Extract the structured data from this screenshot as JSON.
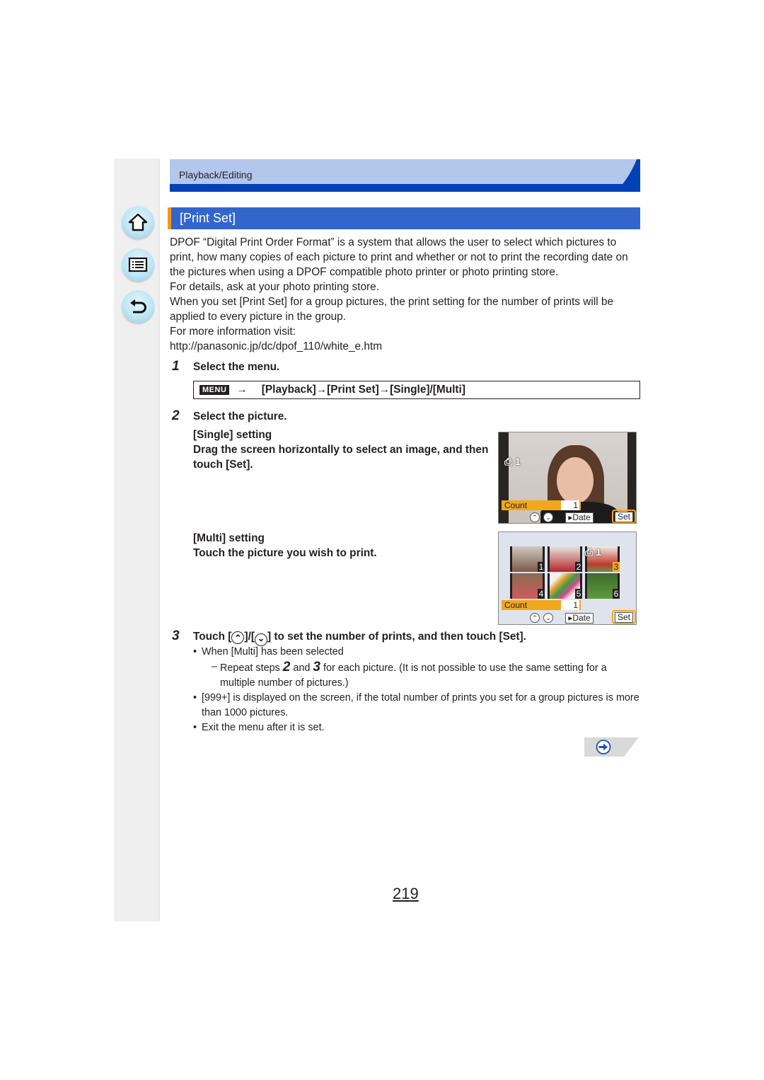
{
  "header": {
    "section": "Playback/Editing"
  },
  "nav": {
    "home_icon": "home-icon",
    "menu_icon": "menu-list-icon",
    "back_icon": "back-arrow-icon"
  },
  "title": "[Print Set]",
  "intro": {
    "p1": "DPOF “Digital Print Order Format” is a system that allows the user to select which pictures to print, how many copies of each picture to print and whether or not to print the recording date on the pictures when using a DPOF compatible photo printer or photo printing store.",
    "p2": "For details, ask at your photo printing store.",
    "p3": "When you set [Print Set] for a group pictures, the print setting for the number of prints will be applied to every picture in the group.",
    "p4": "For more information visit:",
    "url": "http://panasonic.jp/dc/dpof_110/white_e.htm"
  },
  "steps": [
    {
      "number": "1",
      "title": "Select the menu.",
      "menu_badge": "MENU",
      "menu_arrow": "→",
      "menu_path": "[Playback]→[Print Set]→[Single]/[Multi]"
    },
    {
      "number": "2",
      "title": "Select the picture.",
      "single_heading": "[Single] setting",
      "single_instruction": "Drag the screen horizontally to select an image, and then touch [Set].",
      "multi_heading": "[Multi] setting",
      "multi_instruction": "Touch the picture you wish to print."
    },
    {
      "number": "3",
      "title_pre": "Touch [",
      "up_symbol": "⌃",
      "title_mid": "]/[",
      "down_symbol": "⌄",
      "title_post": "] to set the number of prints, and then touch [Set]."
    }
  ],
  "screen_single": {
    "print_mark": "⎙ 1",
    "count_label": "Count",
    "count_value": "1",
    "date_label": "▸Date",
    "set_label": "Set"
  },
  "screen_multi": {
    "print_mark": "⎙ 1",
    "thumbnails": [
      "1",
      "2",
      "3",
      "4",
      "5",
      "6"
    ],
    "selected_thumbnail": "3",
    "count_label": "Count",
    "count_value": "1",
    "date_label": "▸Date",
    "set_label": "Set"
  },
  "notes": {
    "b1": "When [Multi] has been selected",
    "dash_mark": "–",
    "d1_pre": "Repeat steps ",
    "d1_n1": "2",
    "d1_mid": " and ",
    "d1_n2": "3",
    "d1_post": " for each picture. (It is not possible to use the same setting for a multiple number of pictures.)",
    "b2": "[999+] is displayed on the screen, if the total number of prints you set for a group pictures is more than 1000 pictures.",
    "b3": "Exit the menu after it is set."
  },
  "footer": {
    "next_icon": "next-page-arrow-icon",
    "page_number": "219"
  },
  "colors": {
    "header_band": "#b3c6ec",
    "header_rule": "#0041b8",
    "title_bg": "#3366cc",
    "title_accent": "#f2991d",
    "count_bar": "#f2a81d"
  }
}
